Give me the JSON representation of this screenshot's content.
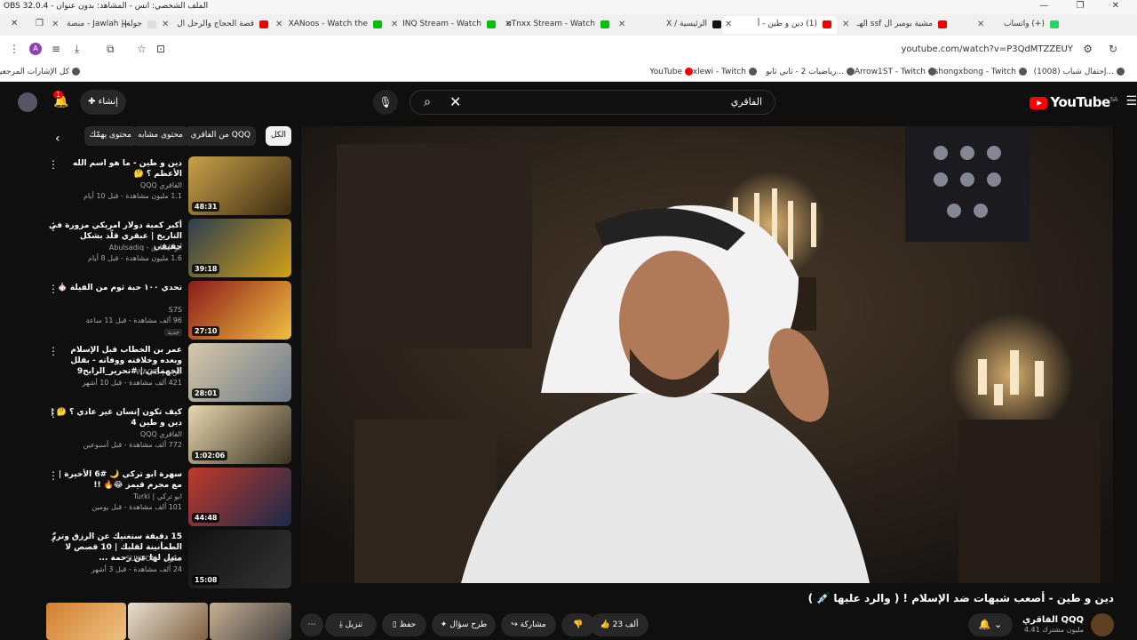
{
  "obs_title": "OBS 32.0.4 - الملف الشخصي: انس - المشاهد: بدون عنوان",
  "tabs": [
    {
      "label": "(+) واتساب",
      "color": "#25d366"
    },
    {
      "label": "مشية بومبر ال ssf الهـ",
      "color": "#e00"
    },
    {
      "label": "(1) دين و طين - أ",
      "color": "#e00"
    },
    {
      "label": "الرئيسية / X",
      "color": "#111"
    },
    {
      "label": "oTnxx Stream - Watch",
      "color": "#00c000"
    },
    {
      "label": "INQ Stream - Watch",
      "color": "#00c000"
    },
    {
      "label": "XANoos - Watch the",
      "color": "#00c000"
    },
    {
      "label": "قصة الحجاج والرحل ال",
      "color": "#e00"
    },
    {
      "label": "جولة | Jawlah - منصة",
      "color": "#ddd"
    }
  ],
  "url": "youtube.com/watch?v=P3QdMTZZEUY",
  "profile_initial": "A",
  "bookmarks": [
    {
      "label": "(1008) إحتفال شباب..."
    },
    {
      "label": "shongxbong - Twitch"
    },
    {
      "label": "Arrow1ST - Twitch"
    },
    {
      "label": "رياضيات 2 - ثاني ثانو..."
    },
    {
      "label": "xlewi - Twitch"
    },
    {
      "label": "YouTube"
    },
    {
      "label": "كل الإشارات المرجعية"
    }
  ],
  "yt": {
    "logo": "YouTube",
    "region": "SA",
    "search_query": "الفاقري",
    "create_label": "إنشاء",
    "notif_count": "1"
  },
  "chips": [
    "الكل",
    "من الفاقري QQQ",
    "محتوى مشابه",
    "محتوى يهمّك"
  ],
  "recs": [
    {
      "title": "دين و طين - ما هو اسم الله الأعظم ؟ 🤔",
      "channel": "الفاقري QQQ",
      "meta": "1.1 مليون مشاهدة - قبل 10 أيام",
      "dur": "48:31",
      "c1": "#c9a24a",
      "c2": "#3a2a10"
    },
    {
      "title": "أكبر كمية دولار امريكي مزورة في التاريخ | عبقري قلّد بشكل حقيقي",
      "channel": "أبو الصادق - Abulsadiq",
      "meta": "1.6 مليون مشاهدة - قبل 8 أيام",
      "dur": "39:18",
      "c1": "#2c3e50",
      "c2": "#d4a017"
    },
    {
      "title": "تحدي ١٠٠ حبة ثوم من الفيلة 🧄",
      "channel": "S7S",
      "meta": "96 ألف مشاهدة - قبل 11 ساعة",
      "dur": "27:10",
      "c1": "#8b1a1a",
      "c2": "#f0c040",
      "badge": "جديد"
    },
    {
      "title": "عمر بن الخطاب قبل الإسلام وبعده وخلافته ووفاته - بقلل الجهماني | #تحرير_الرابح9",
      "channel": "الرابع | WAQIE",
      "meta": "421 ألف مشاهدة - قبل 10 أشهر",
      "dur": "28:01",
      "c1": "#d8c8a8",
      "c2": "#6a7a8a"
    },
    {
      "title": "كيف تكون إنسان غير عادي ؟ 🤔 | دين و طين 4",
      "channel": "الفاقري QQQ",
      "meta": "772 ألف مشاهدة - قبل أسبوعين",
      "dur": "1:02:06",
      "c1": "#e8d8b0",
      "c2": "#3a3020"
    },
    {
      "title": "سهرة ابو تركي 🌙 #6 الأخيرة | مع مجرم قيمز 😂🔥 !!",
      "channel": "ابو تركي | Turki",
      "meta": "101 ألف مشاهدة - قبل يومين",
      "dur": "44:48",
      "c1": "#c0392b",
      "c2": "#1a2a4a"
    },
    {
      "title": "15 دقيقة ستغنيك عن الرزق وترزّ الطمأنينة لقلبك | 10 قصص لا مثيل لها عن رحمة ...",
      "channel": "سكون - SUKOON",
      "meta": "24 ألف مشاهدة - قبل 3 أشهر",
      "dur": "15:08",
      "c1": "#111",
      "c2": "#333"
    }
  ],
  "video": {
    "title": "دين و طين - أصعب شبهات ضد الإسلام ! ( والرد عليها 💉 )",
    "channel": "الفاقري QQQ",
    "subs": "4.41 مليون مشترك"
  },
  "actions": {
    "likes": "23 ألف",
    "share": "مشاركة",
    "ask": "طرح سؤال",
    "save": "حفظ",
    "download": "تنزيل"
  }
}
